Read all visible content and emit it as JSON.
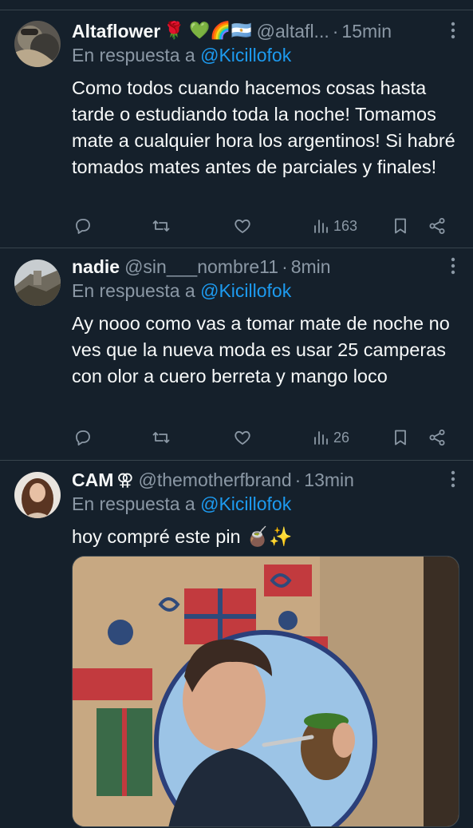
{
  "tweets": [
    {
      "name": "Altaflower",
      "emojis": "🌹 💚🌈🇦🇷",
      "handle": "@altafl...",
      "time": "15min",
      "reply_prefix": "En respuesta a",
      "reply_mention": "@Kicillofok",
      "text": "Como todos cuando hacemos cosas hasta tarde o estudiando toda la noche! Tomamos mate a cualquier hora los argentinos! Si habré tomados mates antes de parciales y finales!",
      "views": "163"
    },
    {
      "name": "nadie",
      "emojis": "",
      "handle": "@sin___nombre11",
      "time": "8min",
      "reply_prefix": "En respuesta a",
      "reply_mention": "@Kicillofok",
      "text": "Ay nooo como vas a tomar mate de noche no ves que la nueva moda es usar 25 camperas con olor a cuero berreta y mango loco",
      "views": "26"
    },
    {
      "name": "CAM",
      "emojis": "⚢",
      "handle": "@themotherfbrand",
      "time": "13min",
      "reply_prefix": "En respuesta a",
      "reply_mention": "@Kicillofok",
      "text": "hoy compré este pin 🧉✨",
      "views": ""
    }
  ],
  "separator": "·",
  "colors": {
    "background": "#15202b",
    "secondary_text": "#8b98a5",
    "link": "#1d9bf0",
    "divider": "#38444d"
  },
  "icons": [
    "reply-icon",
    "retweet-icon",
    "like-icon",
    "views-icon",
    "bookmark-icon",
    "share-icon",
    "more-icon"
  ]
}
